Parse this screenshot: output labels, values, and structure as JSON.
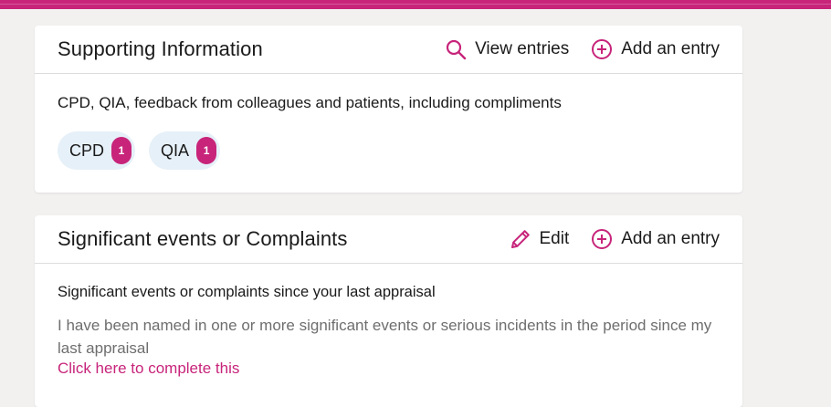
{
  "colors": {
    "accent": "#c7247a",
    "tag_bg": "#e6f0f8",
    "page_bg": "#f2f1f0"
  },
  "supporting": {
    "title": "Supporting Information",
    "view_label": "View entries",
    "add_label": "Add an entry",
    "description": "CPD, QIA, feedback from colleagues and patients, including compliments",
    "tags": [
      {
        "label": "CPD",
        "count": "1"
      },
      {
        "label": "QIA",
        "count": "1"
      }
    ]
  },
  "significant": {
    "title": "Significant events or Complaints",
    "edit_label": "Edit",
    "add_label": "Add an entry",
    "subheading": "Significant events or complaints since your last appraisal",
    "statement": "I have been named in one or more significant events or serious incidents in the period since my last appraisal",
    "link_label": "Click here to complete this"
  }
}
